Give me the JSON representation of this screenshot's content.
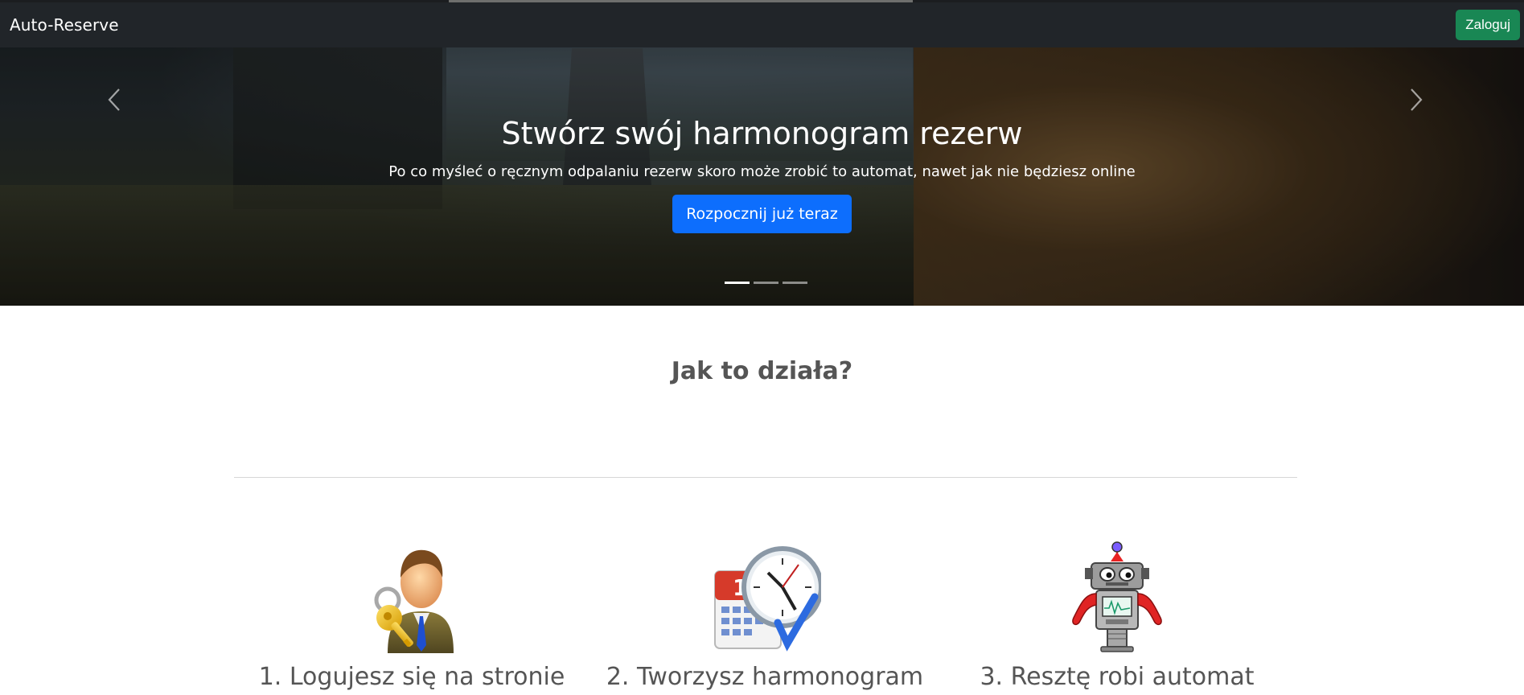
{
  "navbar": {
    "brand": "Auto-Reserve",
    "login_label": "Zaloguj"
  },
  "hero": {
    "title": "Stwórz swój harmonogram rezerw",
    "subtitle": "Po co myśleć o ręcznym odpalaniu rezerw skoro może zrobić to automat, nawet jak nie będziesz online",
    "cta_label": "Rozpocznij już teraz",
    "slides_count": 3,
    "active_slide": 1
  },
  "how_it_works": {
    "title": "Jak to działa?",
    "steps": [
      {
        "label": "1. Logujesz się na stronie",
        "icon": "user-key-icon"
      },
      {
        "label": "2. Tworzysz harmonogram",
        "icon": "calendar-clock-icon"
      },
      {
        "label": "3. Resztę robi automat",
        "icon": "robot-icon"
      }
    ]
  },
  "colors": {
    "navbar_bg": "#212529",
    "login_button": "#198754",
    "cta_button": "#0d6efd",
    "heading_text": "#555555"
  },
  "calendar_day": "12"
}
